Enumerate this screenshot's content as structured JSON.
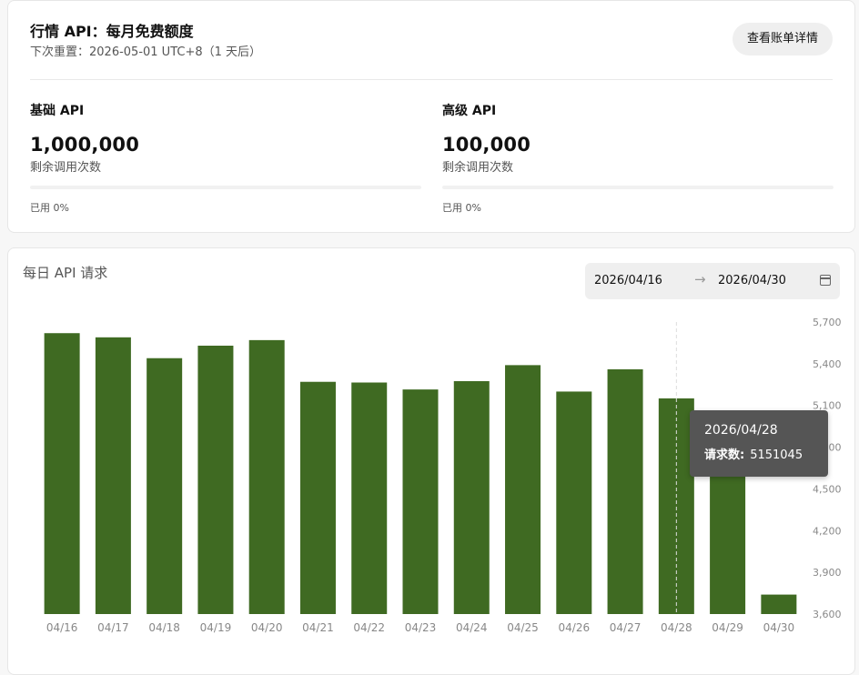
{
  "quota": {
    "title": "行情 API：每月免费额度",
    "reset": "下次重置：2026-05-01 UTC+8（1 天后）",
    "billing_button": "查看账单详情",
    "basic": {
      "name": "基础 API",
      "count": "1,000,000",
      "count_label": "剩余调用次数",
      "used": "已用 0%",
      "used_fraction": 0
    },
    "advanced": {
      "name": "高级 API",
      "count": "100,000",
      "count_label": "剩余调用次数",
      "used": "已用 0%",
      "used_fraction": 0
    }
  },
  "chart": {
    "title": "每日 API 请求",
    "date_start": "2026/04/16",
    "date_arrow": "→",
    "date_end": "2026/04/30",
    "calendar_icon": "calendar-icon",
    "bar_color": "#3f6a22",
    "tooltip": {
      "date": "2026/04/28",
      "label": "请求数:",
      "value": "5151045"
    }
  },
  "chart_data": {
    "type": "bar",
    "categories": [
      "04/16",
      "04/17",
      "04/18",
      "04/19",
      "04/20",
      "04/21",
      "04/22",
      "04/23",
      "04/24",
      "04/25",
      "04/26",
      "04/27",
      "04/28",
      "04/29",
      "04/30"
    ],
    "values": [
      5620000,
      5590000,
      5440000,
      5530000,
      5570000,
      5270000,
      5265000,
      5215000,
      5275000,
      5390000,
      5200000,
      5360000,
      5151045,
      4900000,
      3740000
    ],
    "ylim": [
      3600000,
      5700000
    ],
    "y_ticks": [
      "5,700",
      "5,400",
      "5,100",
      "4,800",
      "4,500",
      "4,200",
      "3,900",
      "3,600"
    ],
    "y_tick_values": [
      5700000,
      5400000,
      5100000,
      4800000,
      4500000,
      4200000,
      3900000,
      3600000
    ],
    "highlight_index": 12
  }
}
